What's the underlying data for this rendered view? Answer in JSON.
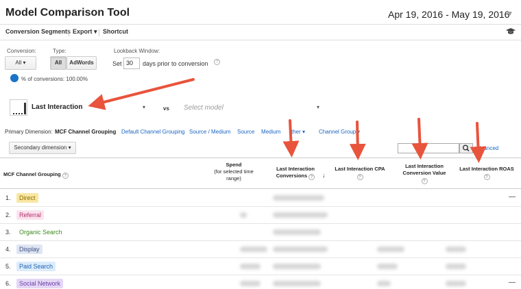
{
  "header": {
    "title": "Model Comparison Tool",
    "date_start": "Apr 19, 2016",
    "date_sep": "-",
    "date_end": "May 19, 2016"
  },
  "toolbar": {
    "conversion_segments": "Conversion Segments",
    "export": "Export",
    "shortcut": "Shortcut"
  },
  "filters": {
    "conversion_label": "Conversion:",
    "conversion_value": "All",
    "type_label": "Type:",
    "type_all": "All",
    "type_adwords": "AdWords",
    "lookback_label": "Lookback Window:",
    "lookback_set": "Set",
    "lookback_days": "30",
    "lookback_suffix": "days prior to conversion",
    "percent_text": "% of conversions: 100.00%"
  },
  "models": {
    "primary": "Last Interaction",
    "vs": "vs",
    "secondary_placeholder": "Select model"
  },
  "dimensions": {
    "label": "Primary Dimension:",
    "active": "MCF Channel Grouping",
    "links": [
      "Default Channel Grouping",
      "Source / Medium",
      "Source",
      "Medium",
      "ther",
      "Channel Groupi"
    ],
    "secondary_button": "Secondary dimension",
    "advanced": "dvanced"
  },
  "table": {
    "col_channel": "MCF Channel Grouping",
    "col_spend_1": "Spend",
    "col_spend_2": "(for selected time",
    "col_spend_3": "range)",
    "col_conv_1": "Last Interaction",
    "col_conv_2": "Conversions",
    "col_cpa": "Last Interaction CPA",
    "col_value_1": "Last Interaction",
    "col_value_2": "Conversion Value",
    "col_roas": "Last Interaction ROAS",
    "rows": [
      {
        "num": "1.",
        "name": "Direct",
        "bg": "#f9e7a3",
        "fg": "#8a6d00",
        "dash": "—"
      },
      {
        "num": "2.",
        "name": "Referral",
        "bg": "#fbe3ee",
        "fg": "#b0306a",
        "dash": ""
      },
      {
        "num": "3.",
        "name": "Organic Search",
        "bg": "#ffffff",
        "fg": "#3d8a1e",
        "dash": ""
      },
      {
        "num": "4.",
        "name": "Display",
        "bg": "#dfe6f3",
        "fg": "#3c4f80",
        "dash": ""
      },
      {
        "num": "5.",
        "name": "Paid Search",
        "bg": "#dcecfb",
        "fg": "#1e63b3",
        "dash": ""
      },
      {
        "num": "6.",
        "name": "Social Network",
        "bg": "#e4d7f5",
        "fg": "#6a3ea8",
        "dash": "—"
      }
    ]
  },
  "colors": {
    "annotation_arrow": "#e8543c",
    "link": "#1a66c2"
  }
}
